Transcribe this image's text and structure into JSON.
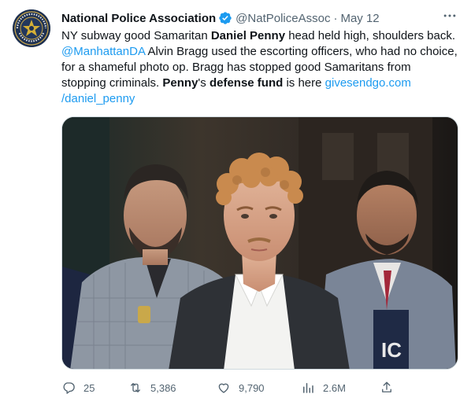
{
  "tweet": {
    "author": {
      "display_name": "National Police Association",
      "handle": "@NatPoliceAssoc",
      "separator": "·",
      "date": "May 12",
      "avatar_icon": "national-police-association-seal",
      "verified_icon": "verified-badge-icon",
      "avatar_seal_text": "NATIONAL POLICE ASSOCIATION"
    },
    "more_icon": "more-horizontal-icon",
    "text": {
      "s1": "NY subway good Samaritan ",
      "s2": "Daniel Penny",
      "s3": " head held high, shoulders back. ",
      "mention": "@ManhattanDA",
      "s4": " Alvin Bragg used the escorting officers, who had no choice, for a shameful photo op. Bragg has stopped good Samaritans from stopping criminals. ",
      "s5": "Penny",
      "s6": "'s ",
      "s7": "defense fund",
      "s8": " is here ",
      "url_line1": "givesendgo.com",
      "url_line2": "/daniel_penny"
    },
    "media": {
      "type": "photo",
      "description_icon": "news-photo"
    },
    "actions": {
      "reply": {
        "icon": "reply-icon",
        "count": "25"
      },
      "retweet": {
        "icon": "retweet-icon",
        "count": "5,386"
      },
      "like": {
        "icon": "heart-icon",
        "count": "9,790"
      },
      "views": {
        "icon": "views-icon",
        "count": "2.6M"
      },
      "share": {
        "icon": "share-icon"
      }
    },
    "colors": {
      "link": "#1d9bf0",
      "secondary_text": "#536471",
      "primary_text": "#0f1419",
      "verified": "#1d9bf0"
    }
  }
}
